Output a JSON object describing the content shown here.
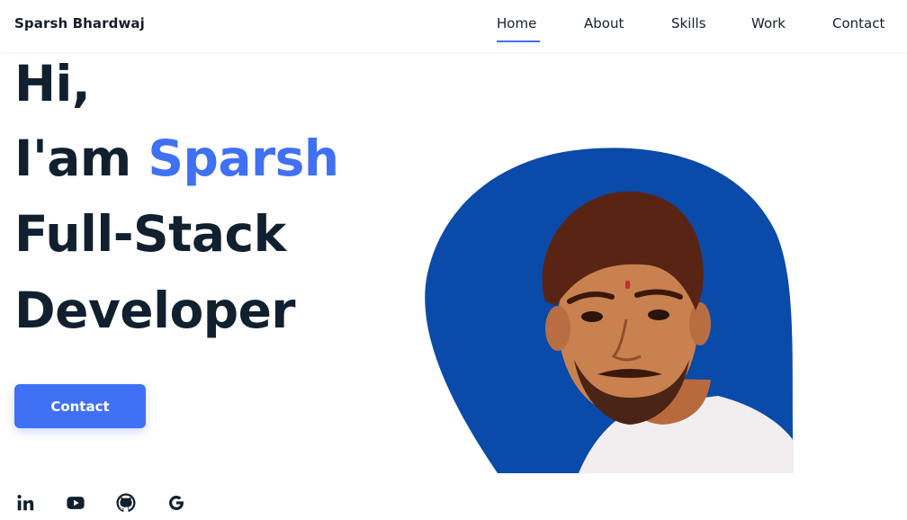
{
  "header": {
    "logo": "Sparsh Bhardwaj",
    "nav": {
      "home": "Home",
      "about": "About",
      "skills": "Skills",
      "work": "Work",
      "contact": "Contact"
    },
    "active_item": "Home"
  },
  "hero": {
    "line1": "Hi,",
    "line2_prefix": "I'am ",
    "line2_name": "Sparsh",
    "line3": "Full-Stack",
    "line4": "Developer",
    "button_label": "Contact"
  },
  "social": {
    "icons": [
      "linkedin-icon",
      "youtube-icon",
      "github-icon",
      "google-icon"
    ]
  },
  "colors": {
    "accent": "#4070f4",
    "blob": "#0a4aa8",
    "text": "#10202e"
  }
}
